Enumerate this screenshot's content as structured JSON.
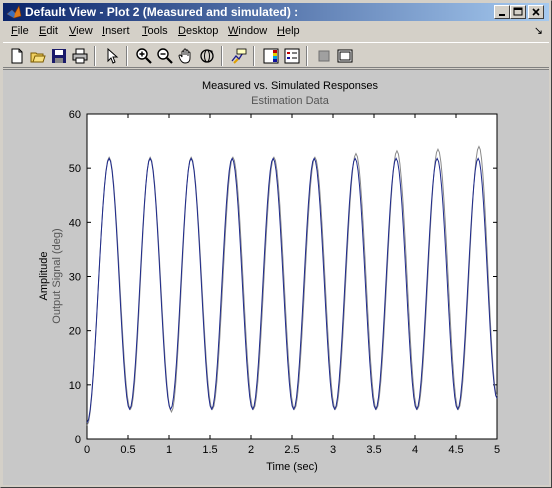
{
  "window": {
    "title": "Default View - Plot 2 (Measured and simulated) :",
    "controls": [
      "minimize-icon",
      "maximize-icon",
      "close-icon"
    ]
  },
  "menu": {
    "items": [
      {
        "label": "File",
        "accel": "F"
      },
      {
        "label": "Edit",
        "accel": "E"
      },
      {
        "label": "View",
        "accel": "V"
      },
      {
        "label": "Insert",
        "accel": "I"
      },
      {
        "label": "Tools",
        "accel": "T"
      },
      {
        "label": "Desktop",
        "accel": "D"
      },
      {
        "label": "Window",
        "accel": "W"
      },
      {
        "label": "Help",
        "accel": "H"
      }
    ],
    "dock_arrow": "↘"
  },
  "toolbar": {
    "icons": [
      "new-figure-icon",
      "open-file-icon",
      "save-icon",
      "print-icon",
      "edit-plot-arrow-icon",
      "zoom-in-icon",
      "zoom-out-icon",
      "pan-hand-icon",
      "rotate-3d-icon",
      "data-cursor-icon",
      "colorbar-icon",
      "legend-icon",
      "hide-plot-tools-icon",
      "show-plot-tools-icon"
    ]
  },
  "colors": {
    "measured": "#8a8a8a",
    "simulated": "#1e2a8c",
    "plot_bg": "#ffffff",
    "figure_bg": "#c8c8c8"
  },
  "chart_data": {
    "type": "line",
    "title": "Measured vs. Simulated Responses",
    "subtitle": "Estimation Data",
    "xlabel": "Time (sec)",
    "ylabel_main": "Amplitude",
    "ylabel_sub": "Output Signal (deg)",
    "xlim": [
      0,
      5
    ],
    "ylim": [
      0,
      60
    ],
    "xticks": [
      0,
      0.5,
      1,
      1.5,
      2,
      2.5,
      3,
      3.5,
      4,
      4.5,
      5
    ],
    "xtick_labels": [
      "0",
      "0.5",
      "1",
      "1.5",
      "2",
      "2.5",
      "3",
      "3.5",
      "4",
      "4.5",
      "5"
    ],
    "yticks": [
      0,
      10,
      20,
      30,
      40,
      50,
      60
    ],
    "ytick_labels": [
      "0",
      "10",
      "20",
      "30",
      "40",
      "50",
      "60"
    ],
    "grid": false,
    "series": [
      {
        "role": "measured",
        "x": [
          0.0,
          0.27,
          0.53,
          0.77,
          1.03,
          1.27,
          1.53,
          1.78,
          2.03,
          2.28,
          2.53,
          2.78,
          3.03,
          3.28,
          3.53,
          3.78,
          4.03,
          4.28,
          4.53,
          4.78,
          5.0
        ],
        "y": [
          2.5,
          52.0,
          5.5,
          52.0,
          5.0,
          52.0,
          5.5,
          52.0,
          5.5,
          52.0,
          5.5,
          52.0,
          5.5,
          52.7,
          5.5,
          53.2,
          5.5,
          53.5,
          5.5,
          54.0,
          8.0
        ]
      },
      {
        "role": "simulated",
        "x": [
          0.0,
          0.27,
          0.52,
          0.77,
          1.02,
          1.27,
          1.52,
          1.77,
          2.02,
          2.27,
          2.52,
          2.77,
          3.02,
          3.27,
          3.52,
          3.77,
          4.02,
          4.27,
          4.52,
          4.77,
          5.0
        ],
        "y": [
          3.0,
          51.8,
          5.5,
          51.8,
          5.5,
          51.8,
          5.5,
          51.8,
          5.5,
          51.8,
          5.5,
          51.8,
          5.5,
          51.8,
          5.5,
          51.8,
          5.5,
          51.8,
          5.5,
          51.8,
          7.5
        ]
      }
    ]
  }
}
